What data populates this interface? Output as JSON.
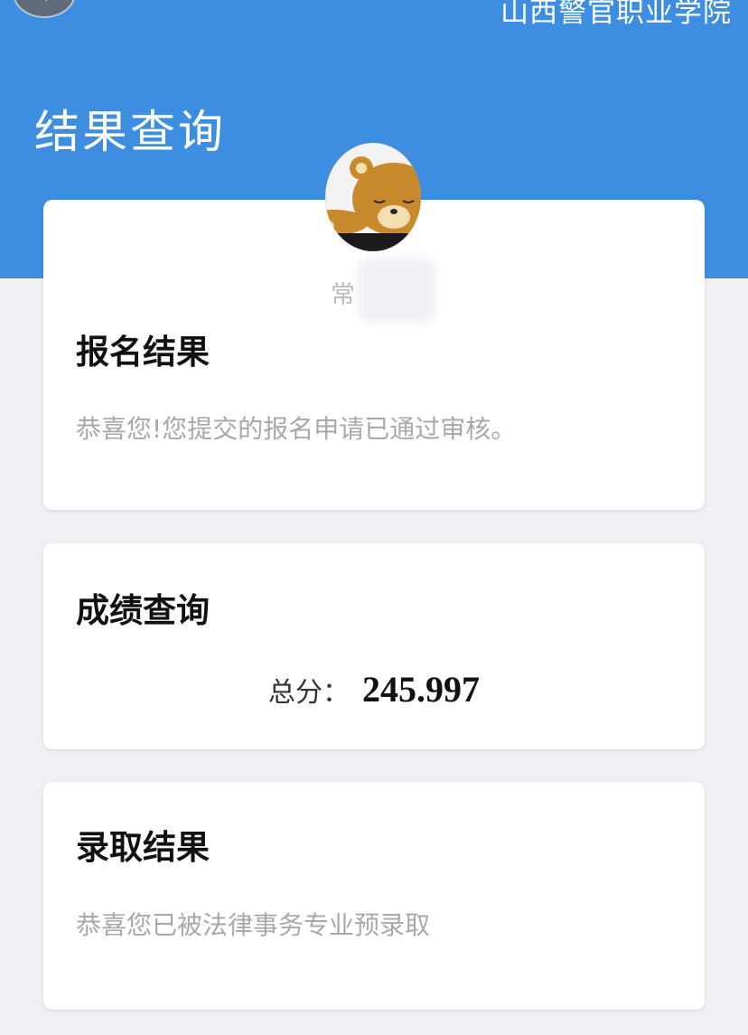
{
  "header": {
    "back_icon": "back-arrow-icon",
    "school_name": "山西警官职业学院",
    "page_title": "结果查询",
    "bg_color": "#3d8ee0"
  },
  "user": {
    "avatar_icon": "bear-avatar-icon",
    "name": "常"
  },
  "signup": {
    "title": "报名结果",
    "message": "恭喜您!您提交的报名申请已通过审核。"
  },
  "score": {
    "title": "成绩查询",
    "label": "总分：",
    "value": "245.997"
  },
  "admission": {
    "title": "录取结果",
    "message": "恭喜您已被法律事务专业预录取"
  }
}
